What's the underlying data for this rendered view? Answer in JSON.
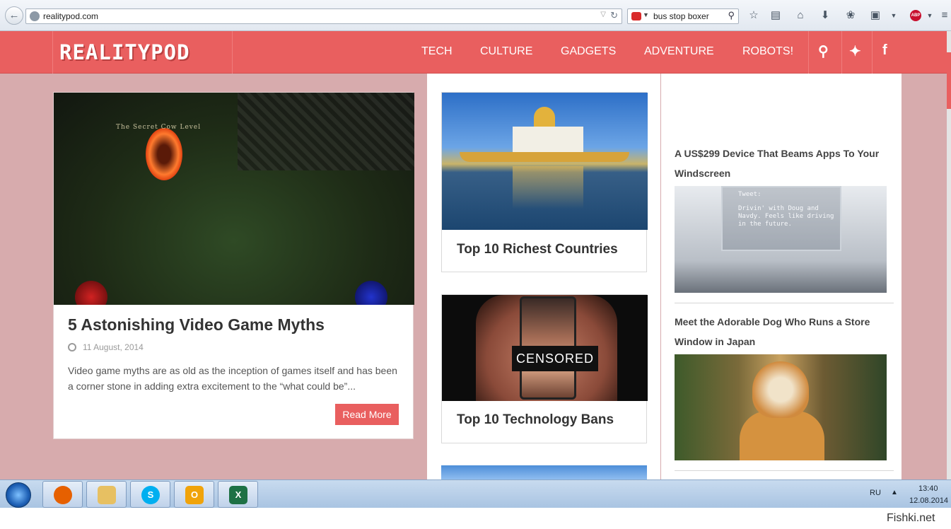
{
  "browser": {
    "url": "realitypod.com",
    "search_value": "bus stop boxer"
  },
  "site": {
    "logo": "REALITYPOD",
    "nav": [
      "TECH",
      "CULTURE",
      "GADGETS",
      "ADVENTURE",
      "ROBOTS!"
    ],
    "brand_color": "#e95f5f"
  },
  "feature": {
    "image_caption": "The Secret Cow Level",
    "title": "5 Astonishing Video Game Myths",
    "date": "11 August, 2014",
    "excerpt": "Video game myths are as old as the inception of games itself and has been a corner stone in adding extra excitement to the “what could be”...",
    "read_more": "Read More"
  },
  "middle_cards": [
    {
      "title": "Top 10 Richest Countries"
    },
    {
      "title": "Top 10 Technology Bans",
      "image_overlay": "CENSORED"
    }
  ],
  "sidebar": [
    {
      "title": "A US$299 Device That Beams Apps To Your Windscreen",
      "image_text": [
        "Tweet:",
        "Drivin' with Doug and",
        "Navdy. Feels like driving",
        "in the future."
      ]
    },
    {
      "title": "Meet the Adorable Dog Who Runs a Store Window in Japan"
    }
  ],
  "taskbar": {
    "lang": "RU",
    "time": "13:40",
    "date": "12.08.2014"
  },
  "watermark": "Fishki.net"
}
